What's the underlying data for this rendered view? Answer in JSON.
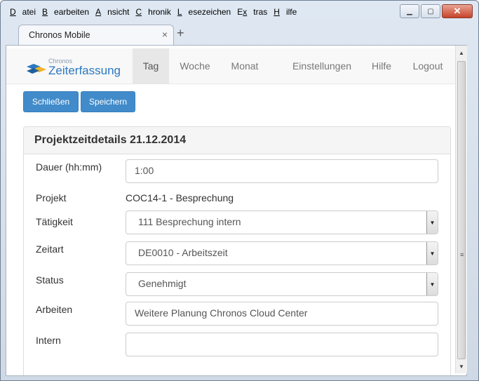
{
  "menu": [
    "Datei",
    "Bearbeiten",
    "Ansicht",
    "Chronik",
    "Lesezeichen",
    "Extras",
    "Hilfe"
  ],
  "menu_underline": [
    "D",
    "B",
    "A",
    "C",
    "L",
    "x",
    "H"
  ],
  "window_controls": {
    "minimize": "▁",
    "maximize": "▢",
    "close": "✕"
  },
  "tab": {
    "title": "Chronos Mobile",
    "close": "×",
    "new": "+"
  },
  "brand": {
    "small": "Chronos",
    "main": "Zeiterfassung"
  },
  "nav": [
    "Tag",
    "Woche",
    "Monat",
    "Einstellungen",
    "Hilfe",
    "Logout"
  ],
  "nav_active": "Tag",
  "buttons": {
    "close": "Schließen",
    "save": "Speichern"
  },
  "panel": {
    "title": "Projektzeitdetails 21.12.2014"
  },
  "form": {
    "duration": {
      "label": "Dauer (hh:mm)",
      "value": "1:00"
    },
    "project": {
      "label": "Projekt",
      "value": "COC14-1 - Besprechung"
    },
    "activity": {
      "label": "Tätigkeit",
      "value": "111 Besprechung intern"
    },
    "timetype": {
      "label": "Zeitart",
      "value": "DE0010 - Arbeitszeit"
    },
    "status": {
      "label": "Status",
      "value": "Genehmigt"
    },
    "work": {
      "label": "Arbeiten",
      "value": "Weitere Planung Chronos Cloud Center"
    },
    "internal": {
      "label": "Intern",
      "value": ""
    }
  },
  "colors": {
    "primary": "#428bca",
    "brand_blue": "#2b78c2",
    "brand_yellow": "#f0b428"
  }
}
